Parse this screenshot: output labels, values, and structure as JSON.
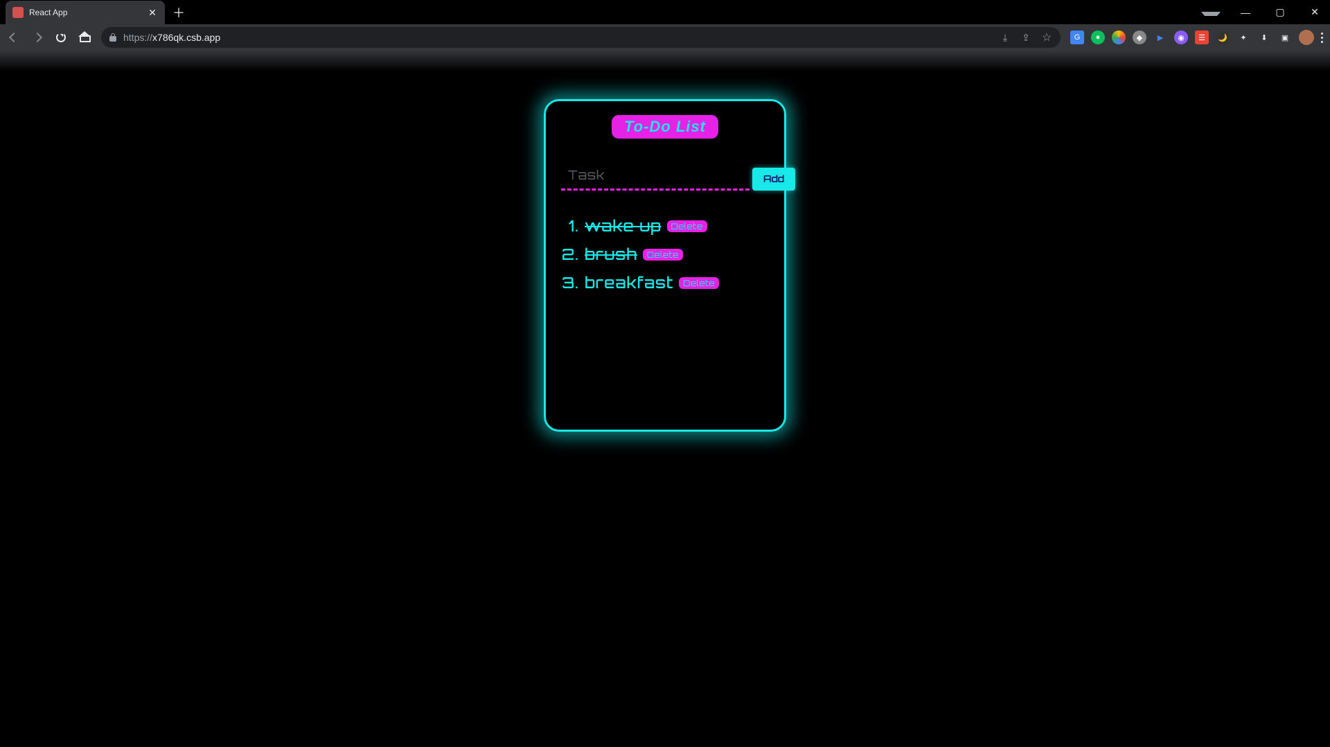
{
  "browser": {
    "tab_title": "React App",
    "url_scheme": "https://",
    "url_host": "x786qk.csb.app"
  },
  "app": {
    "title": "To-Do List",
    "input_placeholder": "Task",
    "add_label": "Add",
    "delete_label": "Delete",
    "items": [
      {
        "num": "1.",
        "text": "wake up",
        "done": true
      },
      {
        "num": "2.",
        "text": "brush",
        "done": true
      },
      {
        "num": "3.",
        "text": "breakfast",
        "done": false
      }
    ]
  }
}
